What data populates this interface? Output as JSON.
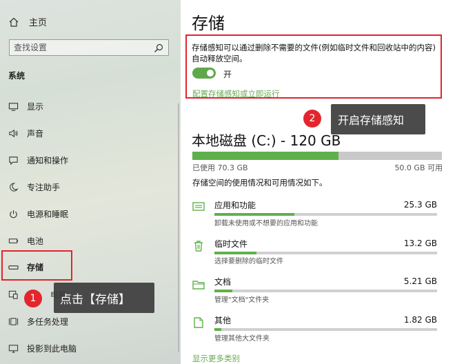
{
  "sidebar": {
    "home_label": "主页",
    "search_placeholder": "查找设置",
    "section_label": "系统",
    "items": [
      {
        "label": "显示",
        "icon": "display-icon"
      },
      {
        "label": "声音",
        "icon": "sound-icon"
      },
      {
        "label": "通知和操作",
        "icon": "notification-icon"
      },
      {
        "label": "专注助手",
        "icon": "moon-icon"
      },
      {
        "label": "电源和睡眠",
        "icon": "power-icon"
      },
      {
        "label": "电池",
        "icon": "battery-icon"
      },
      {
        "label": "存储",
        "icon": "storage-icon"
      },
      {
        "label": "电脑",
        "icon": "tablet-icon"
      },
      {
        "label": "多任务处理",
        "icon": "multitasking-icon"
      },
      {
        "label": "投影到此电脑",
        "icon": "project-icon"
      }
    ]
  },
  "callouts": [
    {
      "number": "1",
      "text": "点击【存储】"
    },
    {
      "number": "2",
      "text": "开启存储感知"
    }
  ],
  "main": {
    "title": "存储",
    "storage_sense": {
      "description": "存储感知可以通过删除不需要的文件(例如临时文件和回收站中的内容)自动释放空间。",
      "toggle_on": true,
      "toggle_label": "开",
      "configure_link": "配置存储感知或立即运行"
    },
    "drive": {
      "title": "本地磁盘 (C:) - 120 GB",
      "used_label": "已使用 70.3 GB",
      "free_label": "50.0 GB 可用",
      "used_fraction": 0.586
    },
    "usage_description": "存储空间的使用情况和可用情况如下。",
    "categories": [
      {
        "name": "应用和功能",
        "size": "25.3 GB",
        "sub": "卸载未使用或不想要的应用和功能",
        "fraction": 0.36,
        "icon": "apps-icon"
      },
      {
        "name": "临时文件",
        "size": "13.2 GB",
        "sub": "选择要删除的临时文件",
        "fraction": 0.19,
        "icon": "trash-icon"
      },
      {
        "name": "文档",
        "size": "5.21 GB",
        "sub": "管理\"文档\"文件夹",
        "fraction": 0.08,
        "icon": "folder-icon"
      },
      {
        "name": "其他",
        "size": "1.82 GB",
        "sub": "管理其他大文件夹",
        "fraction": 0.03,
        "icon": "other-icon"
      }
    ],
    "show_more_link": "显示更多类别"
  },
  "colors": {
    "accent": "#5fb04c",
    "highlight": "#e0242e",
    "callout_bg": "#3c3c3c"
  }
}
